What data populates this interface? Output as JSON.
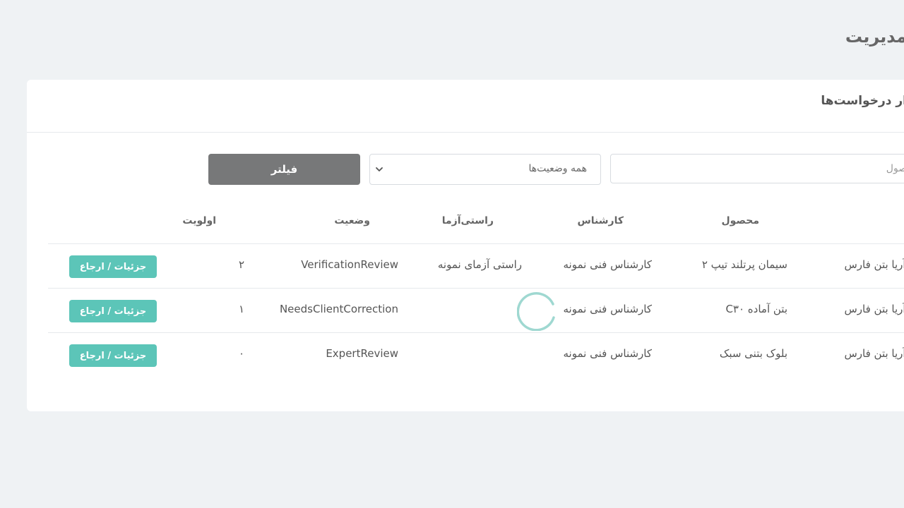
{
  "page": {
    "title": "مدیریت"
  },
  "card": {
    "title": "ار درخواست‌ها"
  },
  "filters": {
    "search_placeholder": "حصول",
    "status_selected": "همه وضعیت‌ها",
    "filter_label": "فیلتر"
  },
  "table": {
    "headers": {
      "product": "محصول",
      "expert": "کارشناس",
      "verifier": "راستی‌آزما",
      "status": "وضعیت",
      "priority": "اولویت"
    },
    "rows": [
      {
        "company": "تولیدی آریا بتن فارس",
        "product": "سیمان پرتلند تیپ ۲",
        "expert": "کارشناس فنی نمونه",
        "verifier": "راستی آزمای نمونه",
        "status": "VerificationReview",
        "priority": "۲",
        "action": "جزئیات / ارجاع"
      },
      {
        "company": "تولیدی آریا بتن فارس",
        "product": "بتن آماده C۳۰",
        "expert": "کارشناس فنی نمونه",
        "verifier": "",
        "status": "NeedsClientCorrection",
        "priority": "۱",
        "action": "جزئیات / ارجاع"
      },
      {
        "company": "تولیدی آریا بتن فارس",
        "product": "بلوک بتنی سبک",
        "expert": "کارشناس فنی نمونه",
        "verifier": "",
        "status": "ExpertReview",
        "priority": "۰",
        "action": "جزئیات / ارجاع"
      }
    ]
  },
  "icons": {
    "select_chevron": "chevron-down-icon",
    "loading": "loading-spinner-icon"
  },
  "colors": {
    "background": "#eff2f4",
    "action_button": "#5cc5b8",
    "filter_button": "#777879",
    "spinner": "#9fd8d1"
  }
}
